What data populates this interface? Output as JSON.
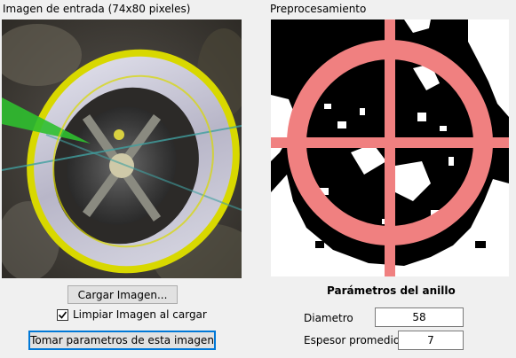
{
  "input_panel": {
    "caption": "Imagen de entrada (74x80 pixeles)"
  },
  "preprocess_panel": {
    "caption": "Preprocesamiento"
  },
  "controls": {
    "load_button": "Cargar Imagen...",
    "clear_checkbox_label": "Limpiar Imagen al cargar",
    "clear_checkbox_checked": true,
    "take_params_button": "Tomar parametros de esta imagen"
  },
  "ring_params": {
    "heading": "Parámetros del anillo",
    "diameter_label": "Diametro",
    "diameter_value": "58",
    "thickness_label": "Espesor promedio",
    "thickness_value": "7"
  },
  "colors": {
    "crosshair": "#f08080",
    "ring_highlight": "#d8d800",
    "default_button_border": "#0078d7"
  }
}
